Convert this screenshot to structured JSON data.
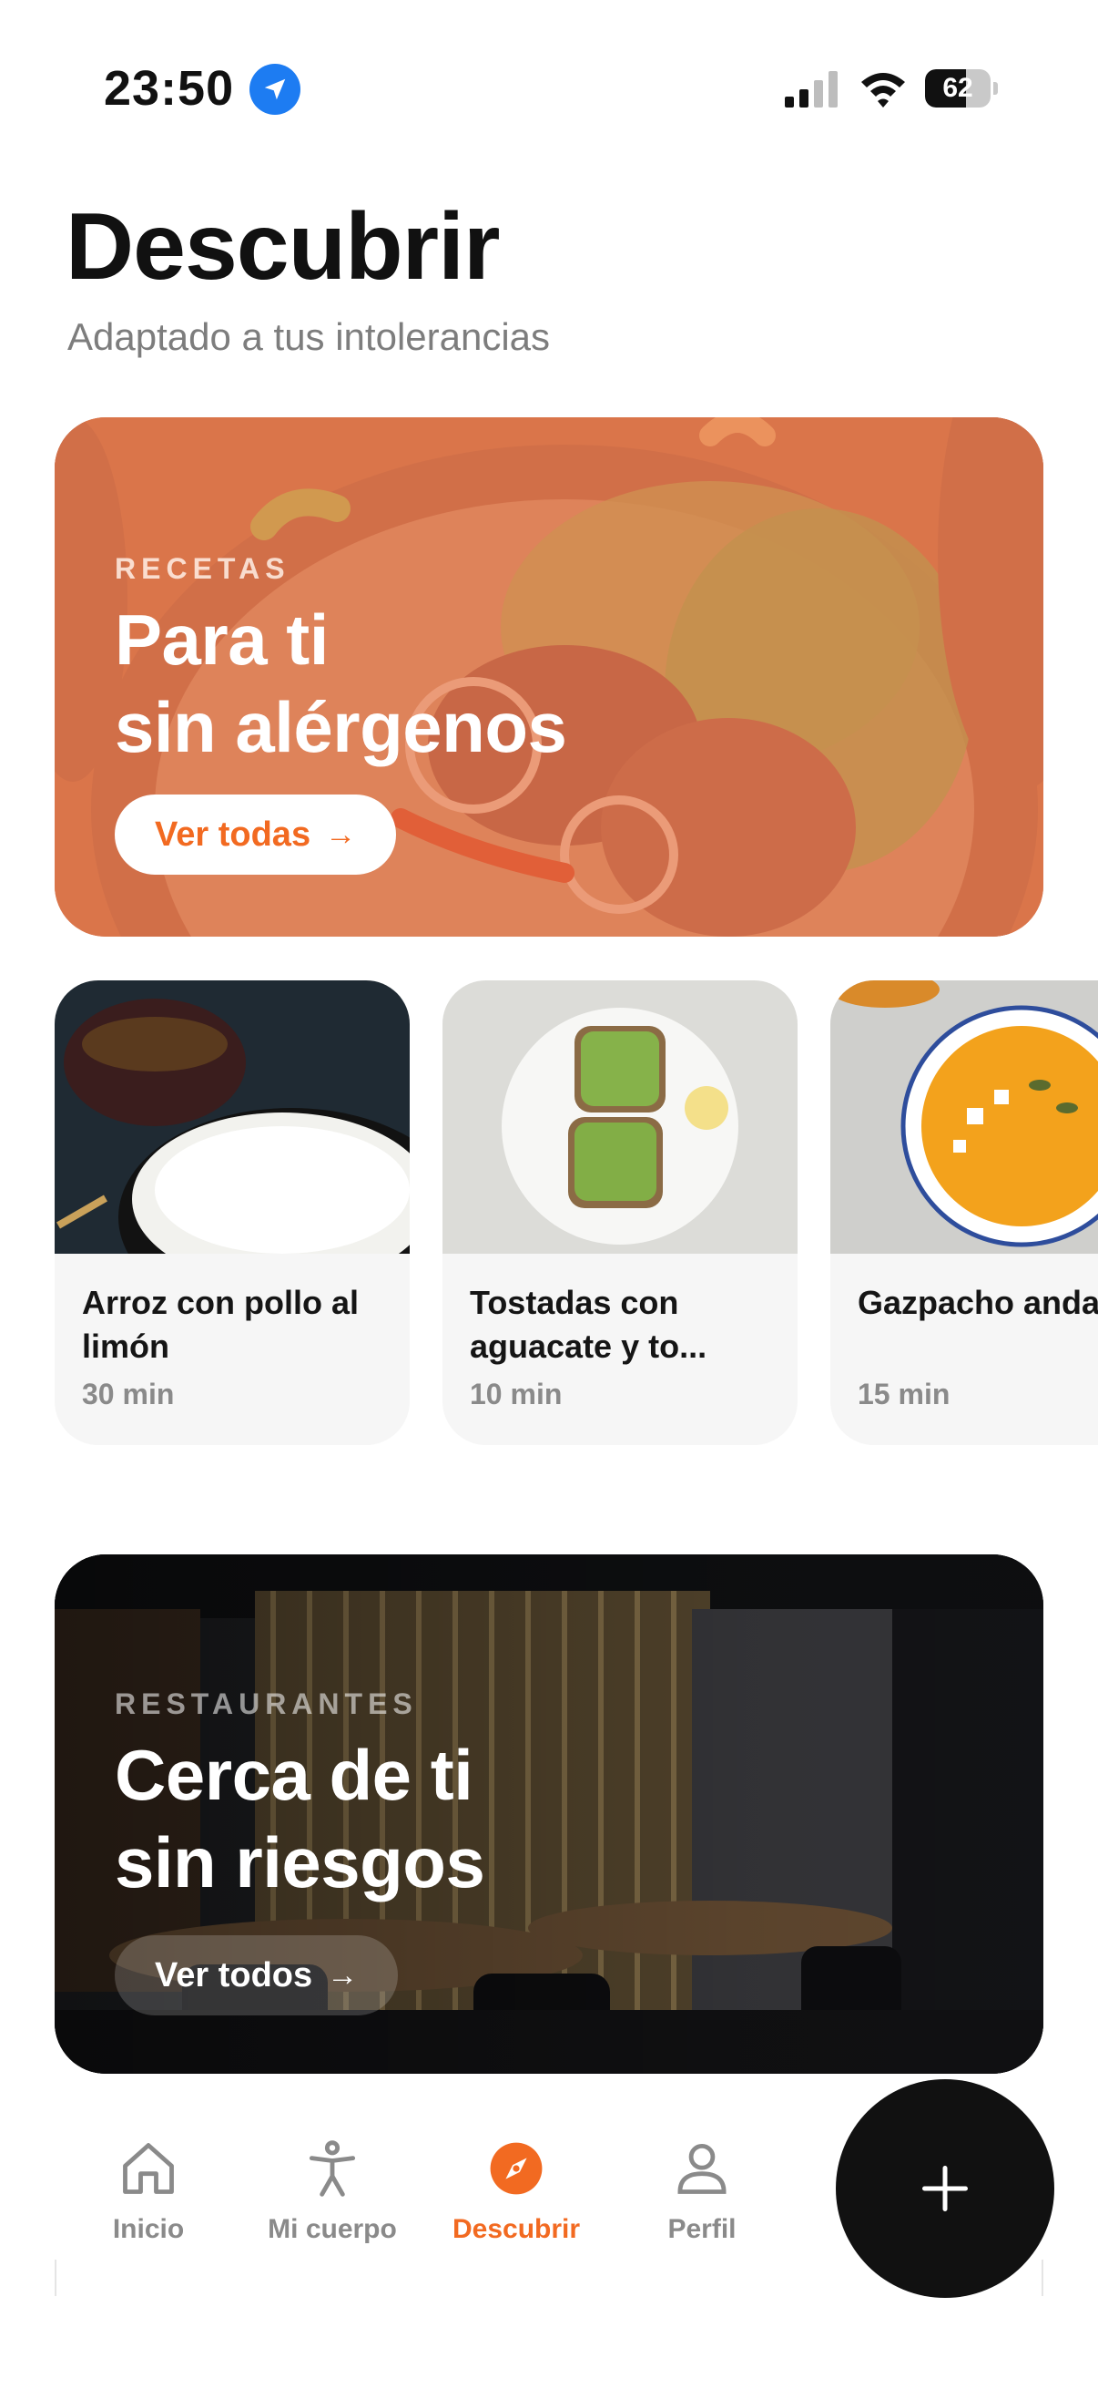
{
  "status": {
    "time": "23:50",
    "battery": "62",
    "battery_level": 0.62,
    "icons": [
      "location-arrow-icon",
      "cellular-signal-icon",
      "wifi-icon",
      "battery-icon"
    ]
  },
  "header": {
    "title": "Descubrir",
    "subtitle": "Adaptado a tus intolerancias"
  },
  "hero_recipes": {
    "eyebrow": "RECETAS",
    "title_line1": "Para ti",
    "title_line2": "sin alérgenos",
    "button_label": "Ver todas",
    "button_arrow": "→"
  },
  "recipes": [
    {
      "name": "Arroz con pollo al limón",
      "time": "30 min"
    },
    {
      "name": "Tostadas con aguacate y to...",
      "time": "10 min"
    },
    {
      "name": "Gazpacho andaluz",
      "time": "15 min"
    }
  ],
  "hero_restaurants": {
    "eyebrow": "RESTAURANTES",
    "title_line1": "Cerca de ti",
    "title_line2": "sin riesgos",
    "button_label": "Ver todos",
    "button_arrow": "→"
  },
  "nav": {
    "items": [
      {
        "label": "Inicio",
        "icon": "home-icon"
      },
      {
        "label": "Mi cuerpo",
        "icon": "body-figure-icon"
      },
      {
        "label": "Descubrir",
        "icon": "compass-icon",
        "active": true
      },
      {
        "label": "Perfil",
        "icon": "person-icon"
      }
    ],
    "fab_icon": "plus-icon"
  },
  "colors": {
    "accent": "#f26a21",
    "location_blue": "#1d7cf2",
    "recipes_hero": "#d9825e",
    "restaurants_hero": "#2a2a2c",
    "fab": "#111111",
    "muted_text": "#8a8a8a"
  }
}
